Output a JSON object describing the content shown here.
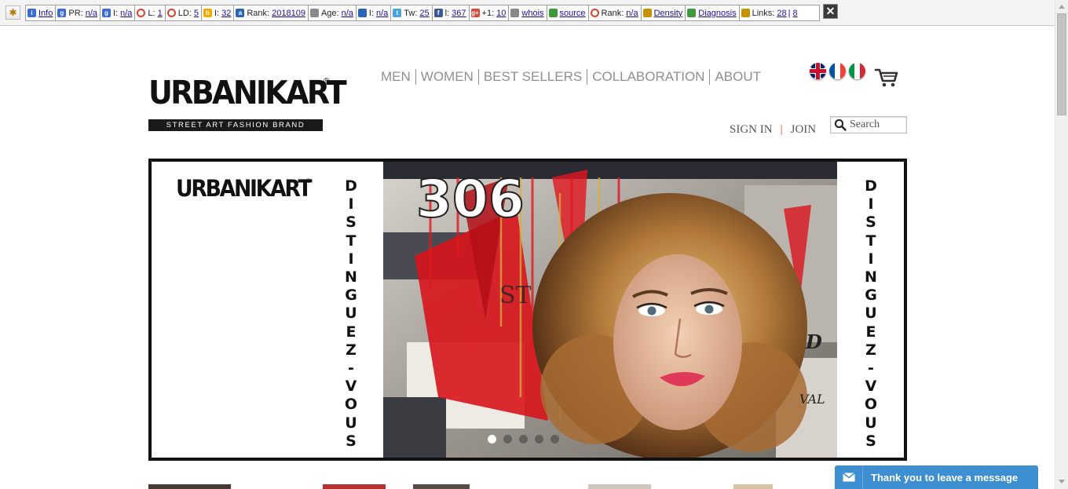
{
  "toolbar": {
    "segments": [
      {
        "icon": "info-icon",
        "color": "#3b6bd3",
        "glyph": "i",
        "label": "",
        "links": [
          "Info"
        ]
      },
      {
        "icon": "google-icon",
        "color": "#3b6bd3",
        "glyph": "g",
        "label": "PR:",
        "links": [
          "n/a"
        ]
      },
      {
        "icon": "google-index-icon",
        "color": "#3b6bd3",
        "glyph": "g",
        "label": "I:",
        "links": [
          "n/a"
        ]
      },
      {
        "icon": "links-circle-icon",
        "color": "#d9412c",
        "glyph": "",
        "label": "L:",
        "links": [
          "1"
        ]
      },
      {
        "icon": "linkdomains-circle-icon",
        "color": "#d9412c",
        "glyph": "",
        "label": "LD:",
        "links": [
          "5"
        ]
      },
      {
        "icon": "bing-icon",
        "color": "#f2a900",
        "glyph": "b",
        "label": "I:",
        "links": [
          "32"
        ]
      },
      {
        "icon": "alexa-icon",
        "color": "#2a64b8",
        "glyph": "a",
        "label": "Rank:",
        "links": [
          "2018109"
        ]
      },
      {
        "icon": "age-icon",
        "color": "#8a8a8a",
        "glyph": "",
        "label": "Age:",
        "links": [
          "n/a"
        ]
      },
      {
        "icon": "delicious-icon",
        "color": "#2a64b8",
        "glyph": "",
        "label": "I:",
        "links": [
          "n/a"
        ]
      },
      {
        "icon": "twitter-icon",
        "color": "#4aa3df",
        "glyph": "t",
        "label": "Tw:",
        "links": [
          "25"
        ]
      },
      {
        "icon": "facebook-icon",
        "color": "#3b5998",
        "glyph": "f",
        "label": "l:",
        "links": [
          "367"
        ]
      },
      {
        "icon": "googleplus-icon",
        "color": "#d84a38",
        "glyph": "g+",
        "label": "+1:",
        "links": [
          "10"
        ]
      },
      {
        "icon": "whois-icon",
        "color": "#888888",
        "glyph": "",
        "label": "",
        "links": [
          "whois"
        ]
      },
      {
        "icon": "source-icon",
        "color": "#3c9a3c",
        "glyph": "",
        "label": "",
        "links": [
          "source"
        ]
      },
      {
        "icon": "rank-circle-icon",
        "color": "#d9412c",
        "glyph": "",
        "label": "Rank:",
        "links": [
          "n/a"
        ]
      },
      {
        "icon": "density-icon",
        "color": "#c79200",
        "glyph": "",
        "label": "",
        "links": [
          "Density"
        ]
      },
      {
        "icon": "diagnosis-icon",
        "color": "#3c9a3c",
        "glyph": "",
        "label": "",
        "links": [
          "Diagnosis"
        ]
      },
      {
        "icon": "links-gear-icon",
        "color": "#c79200",
        "glyph": "",
        "label": "Links:",
        "links": [
          "28",
          "8"
        ]
      }
    ]
  },
  "header": {
    "logo_text": "URBANIKART",
    "logo_reg": "®",
    "logo_tagline": "STREET ART FASHION BRAND",
    "nav": [
      "MEN",
      "WOMEN",
      "BEST SELLERS",
      "COLLABORATION",
      "ABOUT"
    ],
    "flags": [
      "flag-uk-icon",
      "flag-fr-icon",
      "flag-it-icon"
    ],
    "sign_in": "SIGN IN",
    "account_sep": "|",
    "join": "JOIN",
    "search_placeholder": "Search"
  },
  "banner": {
    "logo_text": "URBANIKART",
    "logo_reg": "®",
    "vertical_text": [
      "D",
      "I",
      "S",
      "T",
      "I",
      "N",
      "G",
      "U",
      "E",
      "Z",
      "-",
      "V",
      "O",
      "U",
      "S"
    ],
    "art_number": "306",
    "slides": 5,
    "active_slide": 1
  },
  "chat": {
    "label": "Thank you to leave a message"
  },
  "colors": {
    "nav": "#8f8f8f",
    "accent_sep": "#d0452c",
    "chat": "#3d8fd1"
  }
}
